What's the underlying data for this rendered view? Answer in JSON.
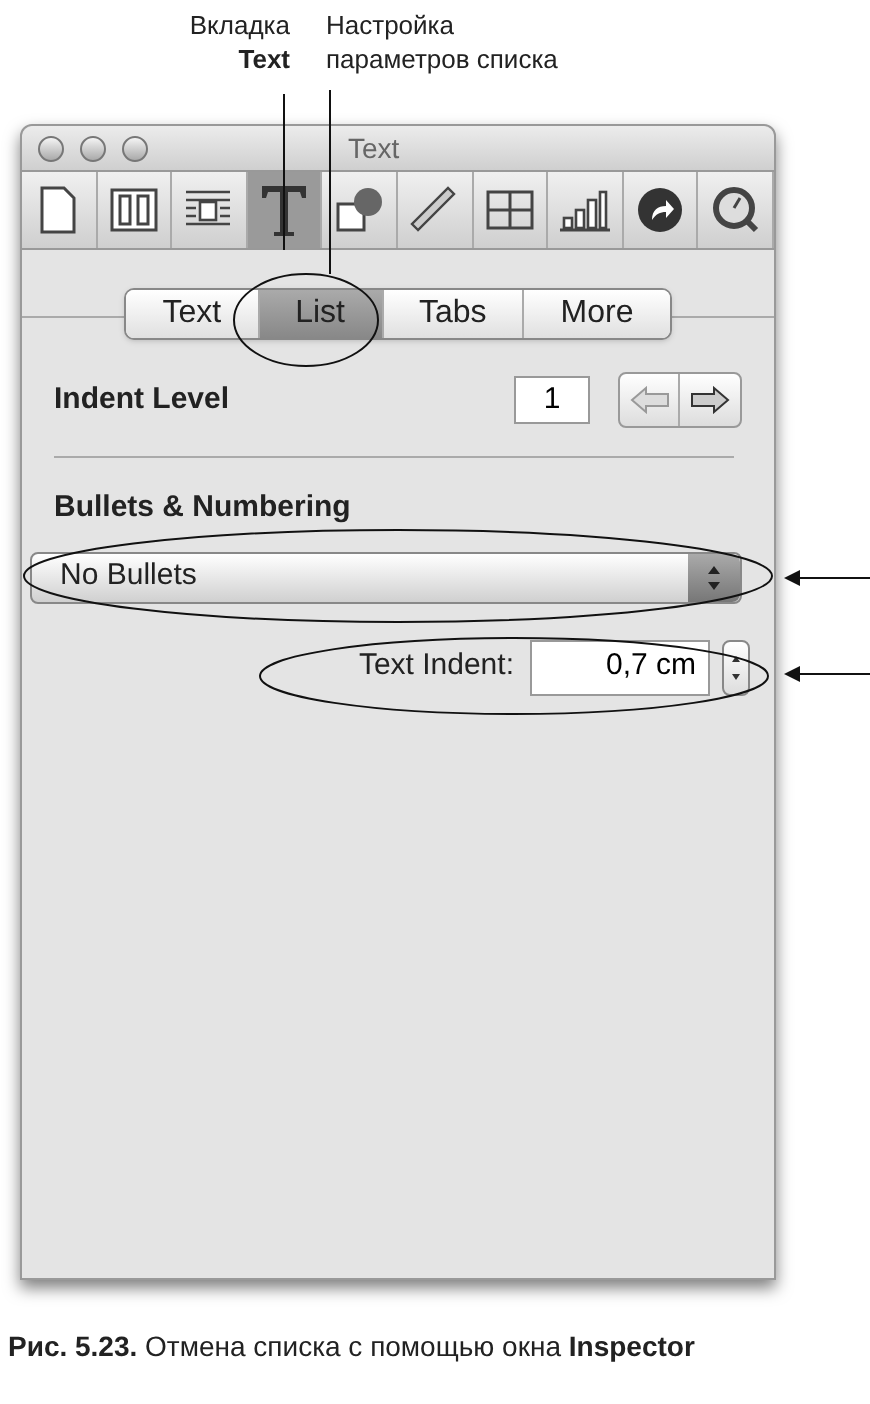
{
  "callouts": {
    "tab_tab": {
      "line_1": "Вкладка",
      "line_2": "Text"
    },
    "list_settings": {
      "line_1": "Настройка",
      "line_2": "параметров списка"
    }
  },
  "window": {
    "title": "Text"
  },
  "toolbar": [
    {
      "selected": false
    },
    {
      "selected": false
    },
    {
      "selected": false
    },
    {
      "selected": true
    },
    {
      "selected": false
    },
    {
      "selected": false
    },
    {
      "selected": false
    },
    {
      "selected": false
    },
    {
      "selected": false
    },
    {
      "selected": false
    }
  ],
  "tabs": [
    {
      "label": "Text",
      "selected": false
    },
    {
      "label": "List",
      "selected": true
    },
    {
      "label": "Tabs",
      "selected": false
    },
    {
      "label": "More",
      "selected": false
    }
  ],
  "indent_level": {
    "label": "Indent Level",
    "value": "1"
  },
  "bullets": {
    "heading": "Bullets & Numbering",
    "popup": "No Bullets"
  },
  "text_indent": {
    "label": "Text Indent:",
    "value": "0,7 cm"
  },
  "caption": "**Рис. 5.23.** Отмена списка с помощью окна **Inspector**"
}
